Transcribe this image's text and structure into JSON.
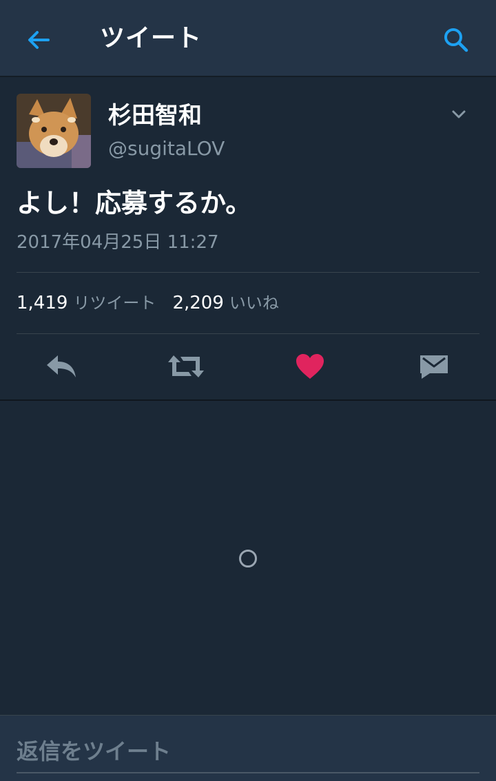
{
  "header": {
    "title": "ツイート",
    "back_icon": "arrow-left-icon",
    "search_icon": "search-icon",
    "accent": "#1da1f2"
  },
  "tweet": {
    "display_name": "杉田智和",
    "handle": "@sugitaLOV",
    "text": "よし！応募するか。",
    "timestamp": "2017年04月25日 11:27",
    "retweets": "1,419",
    "retweets_label": "リツイート",
    "likes": "2,209",
    "likes_label": "いいね",
    "liked": true,
    "like_color": "#e0245e"
  },
  "actions": {
    "reply_icon": "reply-icon",
    "retweet_icon": "retweet-icon",
    "like_icon": "heart-icon",
    "message_icon": "direct-message-icon"
  },
  "reply": {
    "placeholder": "返信をツイート"
  }
}
